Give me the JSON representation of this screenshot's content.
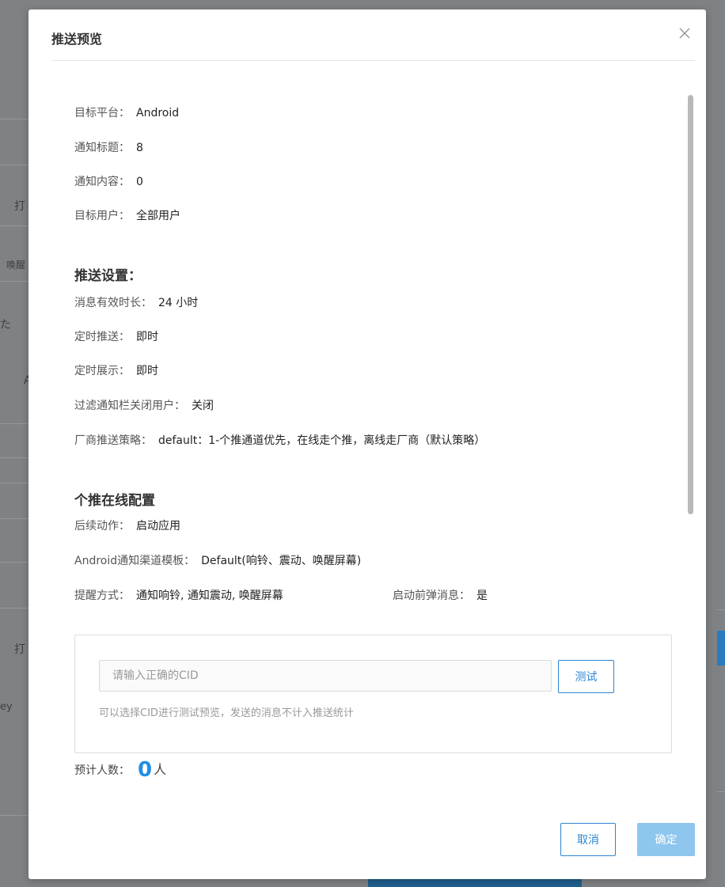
{
  "background": {
    "fragments": [
      "打",
      "唤醒",
      "た",
      "A",
      "打",
      "ey"
    ]
  },
  "modal": {
    "title": "推送预览",
    "info": [
      {
        "label": "目标平台：",
        "value": "Android"
      },
      {
        "label": "通知标题：",
        "value": "8"
      },
      {
        "label": "通知内容：",
        "value": "0"
      },
      {
        "label": "目标用户：",
        "value": "全部用户"
      }
    ],
    "push_settings": {
      "heading": "推送设置：",
      "items": [
        {
          "label": "消息有效时长：",
          "value": "24 小时"
        },
        {
          "label": "定时推送：",
          "value": "即时"
        },
        {
          "label": "定时展示：",
          "value": "即时"
        },
        {
          "label": "过滤通知栏关闭用户：",
          "value": "关闭"
        },
        {
          "label": "厂商推送策略：",
          "value": "default：1-个推通道优先，在线走个推，离线走厂商（默认策略）"
        }
      ]
    },
    "online_config": {
      "heading": "个推在线配置",
      "items": [
        {
          "label": "后续动作：",
          "value": "启动应用"
        },
        {
          "label": "Android通知渠道模板：",
          "value": "Default(响铃、震动、唤醒屏幕)"
        }
      ],
      "alert": {
        "label": "提醒方式：",
        "value": "通知响铃, 通知震动, 唤醒屏幕"
      },
      "popup": {
        "label": "启动前弹消息：",
        "value": "是"
      }
    },
    "test": {
      "placeholder": "请输入正确的CID",
      "button": "测试",
      "hint": "可以选择CID进行测试预览，发送的消息不计入推送统计"
    },
    "estimate": {
      "label": "预计人数：",
      "count": "0",
      "unit": "人"
    },
    "footer": {
      "cancel": "取消",
      "confirm": "确定"
    }
  },
  "colors": {
    "accent": "#2b85d2",
    "count": "#1f8fe6",
    "confirm_disabled": "#8ec6ee"
  }
}
